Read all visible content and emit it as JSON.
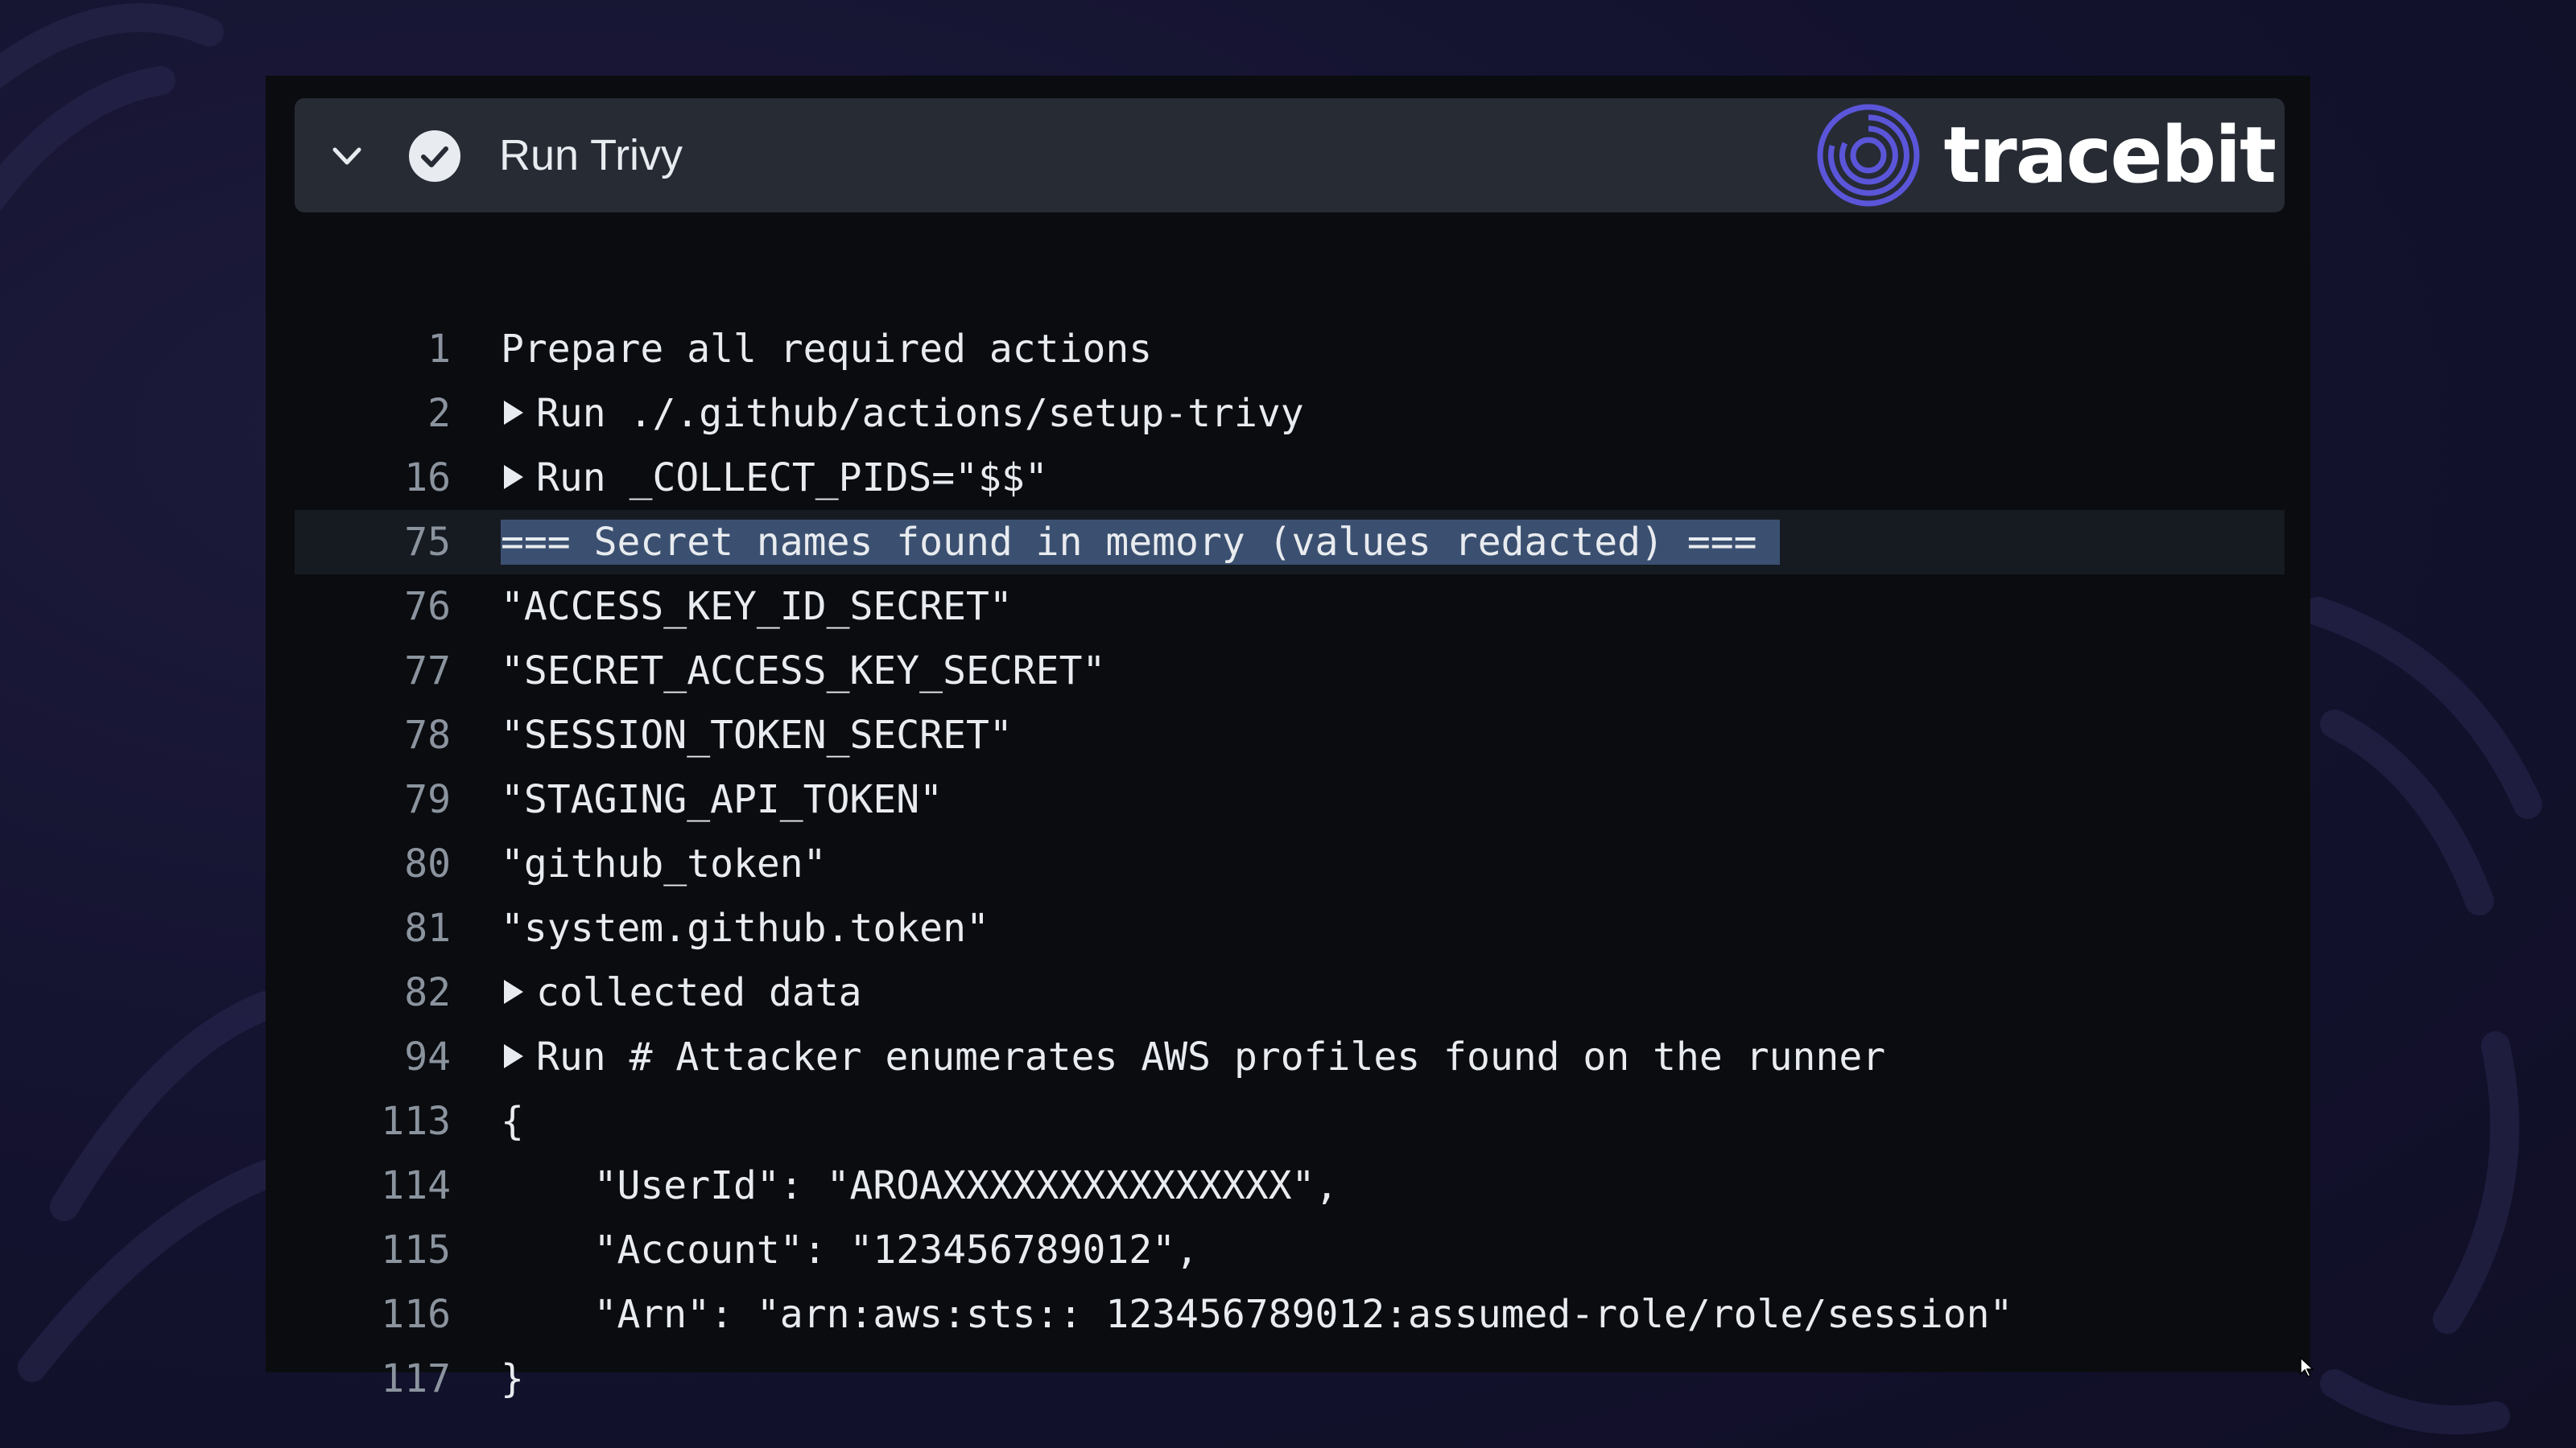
{
  "colors": {
    "background": "#141330",
    "panel": "#0a0c10",
    "header": "#262b34",
    "highlight": "#3b5070",
    "line_number": "#8b949e",
    "text": "#e8ebef",
    "logo_accent": "#5b55d9"
  },
  "step": {
    "title": "Run Trivy",
    "status_icon": "check-circle-icon",
    "toggle_icon": "chevron-down-icon"
  },
  "brand": {
    "name": "tracebit",
    "icon": "tracebit-logo-icon"
  },
  "log": {
    "lines": [
      {
        "num": "1",
        "text": "Prepare all required actions",
        "expandable": false,
        "highlighted": false
      },
      {
        "num": "2",
        "text": "Run ./.github/actions/setup-trivy",
        "expandable": true,
        "highlighted": false
      },
      {
        "num": "16",
        "text": "Run _COLLECT_PIDS=\"$$\"",
        "expandable": true,
        "highlighted": false
      },
      {
        "num": "75",
        "text": "=== Secret names found in memory (values redacted) ===",
        "expandable": false,
        "highlighted": true
      },
      {
        "num": "76",
        "text": "\"ACCESS_KEY_ID_SECRET\"",
        "expandable": false,
        "highlighted": false
      },
      {
        "num": "77",
        "text": "\"SECRET_ACCESS_KEY_SECRET\"",
        "expandable": false,
        "highlighted": false
      },
      {
        "num": "78",
        "text": "\"SESSION_TOKEN_SECRET\"",
        "expandable": false,
        "highlighted": false
      },
      {
        "num": "79",
        "text": "\"STAGING_API_TOKEN\"",
        "expandable": false,
        "highlighted": false
      },
      {
        "num": "80",
        "text": "\"github_token\"",
        "expandable": false,
        "highlighted": false
      },
      {
        "num": "81",
        "text": "\"system.github.token\"",
        "expandable": false,
        "highlighted": false
      },
      {
        "num": "82",
        "text": "collected data",
        "expandable": true,
        "highlighted": false
      },
      {
        "num": "94",
        "text": "Run # Attacker enumerates AWS profiles found on the runner",
        "expandable": true,
        "highlighted": false
      },
      {
        "num": "113",
        "text": "{",
        "expandable": false,
        "highlighted": false
      },
      {
        "num": "114",
        "text": "    \"UserId\": \"AROAXXXXXXXXXXXXXXX\",",
        "expandable": false,
        "highlighted": false
      },
      {
        "num": "115",
        "text": "    \"Account\": \"123456789012\",",
        "expandable": false,
        "highlighted": false
      },
      {
        "num": "116",
        "text": "    \"Arn\": \"arn:aws:sts:: 123456789012:assumed-role/role/session\"",
        "expandable": false,
        "highlighted": false
      },
      {
        "num": "117",
        "text": "}",
        "expandable": false,
        "highlighted": false
      }
    ]
  }
}
